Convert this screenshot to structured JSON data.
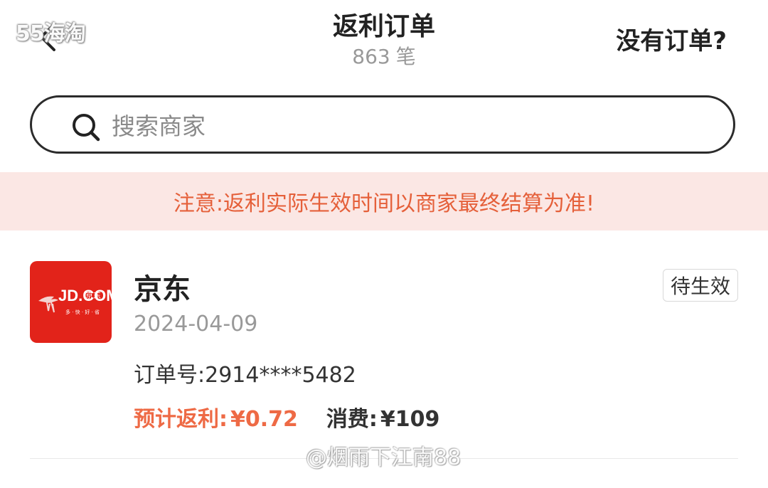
{
  "header": {
    "watermark": "55海淘",
    "title": "返利订单",
    "count": "863",
    "count_unit": "笔",
    "no_order_link": "没有订单?"
  },
  "search": {
    "placeholder": "搜索商家",
    "value": ""
  },
  "notice": "注意:返利实际生效时间以商家最终结算为准!",
  "orders": [
    {
      "merchant": "京东",
      "logo_text": "JD.COM",
      "logo_brand": "京东",
      "logo_tagline": "多 · 快 · 好 · 省",
      "date": "2024-04-09",
      "order_no": "订单号:2914****5482",
      "rebate_label": "预计返利:",
      "rebate_value": "¥0.72",
      "spend_label": "消费:",
      "spend_value": "¥109",
      "status": "待生效"
    }
  ],
  "footer_watermark": "@烟雨下江南88",
  "colors": {
    "accent": "#ee6a45",
    "notice_bg": "#fbe7e4",
    "notice_text": "#e5603a",
    "jd_red": "#e2231a"
  }
}
